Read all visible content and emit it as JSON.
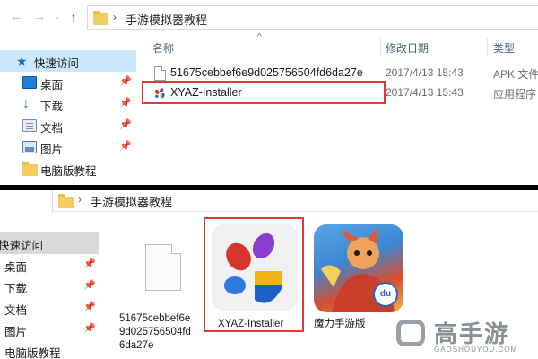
{
  "top": {
    "breadcrumb": {
      "folder": "手游模拟器教程"
    },
    "sidebar": [
      {
        "label": "快速访问",
        "icon": "star-icon",
        "selected": true,
        "pinned": false
      },
      {
        "label": "桌面",
        "icon": "desktop-icon",
        "selected": false,
        "pinned": true
      },
      {
        "label": "下载",
        "icon": "download-icon",
        "selected": false,
        "pinned": true
      },
      {
        "label": "文档",
        "icon": "document-icon",
        "selected": false,
        "pinned": true
      },
      {
        "label": "图片",
        "icon": "pictures-icon",
        "selected": false,
        "pinned": true
      },
      {
        "label": "电脑版教程",
        "icon": "folder-icon",
        "selected": false,
        "pinned": false
      }
    ],
    "columns": {
      "name": "名称",
      "modified": "修改日期",
      "type": "类型"
    },
    "files": [
      {
        "name": "51675cebbef6e9d025756504fd6da27e",
        "modified": "2017/4/13 15:43",
        "type": "APK 文件",
        "icon": "blank-file-icon"
      },
      {
        "name": "XYAZ-Installer",
        "modified": "2017/4/13 15:43",
        "type": "应用程序",
        "icon": "xyaz-app-icon",
        "highlighted": true
      }
    ]
  },
  "bottom": {
    "breadcrumb": {
      "folder": "手游模拟器教程"
    },
    "sidebar": [
      {
        "label": "快速访问",
        "selected": true,
        "pinned": false
      },
      {
        "label": "桌面",
        "selected": false,
        "pinned": true
      },
      {
        "label": "下载",
        "selected": false,
        "pinned": true
      },
      {
        "label": "文档",
        "selected": false,
        "pinned": true
      },
      {
        "label": "图片",
        "selected": false,
        "pinned": true
      },
      {
        "label": "电脑版教程",
        "selected": false,
        "pinned": false
      }
    ],
    "tiles": [
      {
        "label_lines": [
          "51675cebbef6e",
          "9d025756504fd",
          "6da27e"
        ],
        "icon": "blank-file-icon"
      },
      {
        "label_lines": [
          "XYAZ-Installer"
        ],
        "icon": "xyaz-app-icon",
        "highlighted": true
      },
      {
        "label_lines": [
          "魔力手游版"
        ],
        "icon": "game-app-icon"
      }
    ]
  },
  "watermark": {
    "brand": "高手游",
    "domain": "GAOSHOUYOU.COM"
  },
  "colors": {
    "selection": "#cce8ff",
    "highlight": "#e0383a",
    "folder": "#f3cd62"
  }
}
